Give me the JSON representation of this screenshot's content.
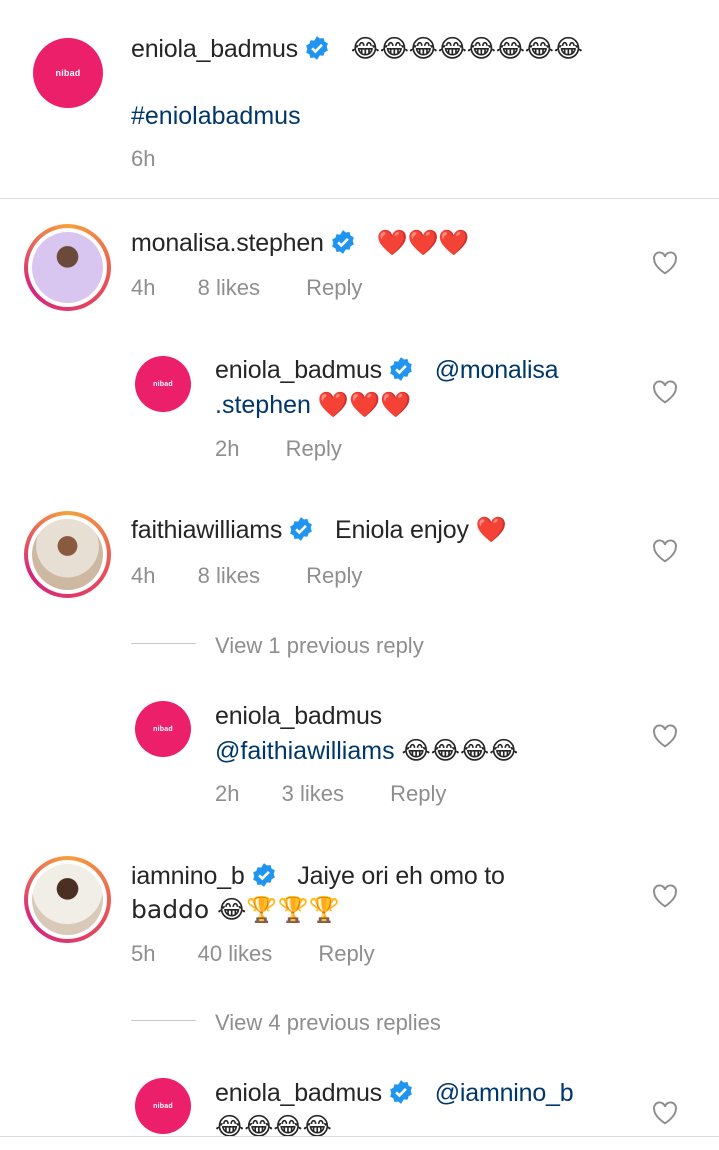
{
  "caption": {
    "username": "eniola_badmus",
    "text": "😂😂😂😂😂😂😂😂",
    "hashtag": "#eniolabadmus",
    "time": "6h",
    "avatar_logo": "nibad"
  },
  "comments": [
    {
      "username": "monalisa.stephen",
      "text": "❤️❤️❤️",
      "time": "4h",
      "likes": "8 likes",
      "reply_label": "Reply",
      "reply": {
        "username": "eniola_badmus",
        "mention_line1": "@monalisa",
        "mention_line2": ".stephen",
        "text": "❤️❤️❤️",
        "time": "2h",
        "reply_label": "Reply",
        "avatar_logo": "nibad"
      }
    },
    {
      "username": "faithiawilliams",
      "text": "Eniola enjoy ❤️",
      "time": "4h",
      "likes": "8 likes",
      "reply_label": "Reply",
      "view_previous": "View 1 previous reply",
      "reply": {
        "username": "eniola_badmus",
        "mention": "@faithiawilliams",
        "text": "😂😂😂😂",
        "time": "2h",
        "likes": "3 likes",
        "reply_label": "Reply",
        "avatar_logo": "nibad"
      }
    },
    {
      "username": "iamnino_b",
      "text_line1": "Jaiye ori eh omo to",
      "text_line2": "baddo 😂🏆🏆🏆",
      "time": "5h",
      "likes": "40 likes",
      "reply_label": "Reply",
      "view_previous": "View 4 previous replies",
      "reply": {
        "username": "eniola_badmus",
        "mention": "@iamnino_b",
        "text": "😂😂😂😂",
        "avatar_logo": "nibad"
      }
    }
  ],
  "colors": {
    "brand": "#ec1f6a",
    "verified": "#1f95f0",
    "mention": "#00376b",
    "meta": "#8e8e8e"
  },
  "icons": {
    "verified": "verified-badge-icon",
    "like": "heart-outline-icon"
  }
}
